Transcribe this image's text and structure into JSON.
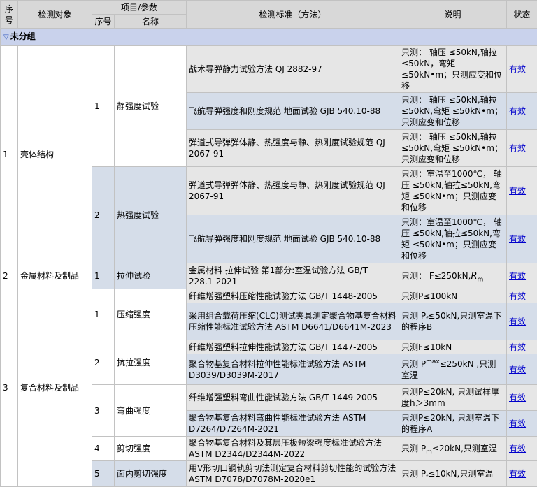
{
  "header": {
    "seq": "序号",
    "object": "检测对象",
    "param": "项目/参数",
    "sub_seq": "序号",
    "name": "名称",
    "standard": "检测标准（方法）",
    "note": "说明",
    "status": "状态"
  },
  "group": {
    "label": "未分组"
  },
  "status_label": "有效",
  "objects": [
    {
      "seq": "1",
      "name": "壳体结构",
      "params": [
        {
          "seq": "1",
          "name": "静强度试验",
          "standards": [
            {
              "text": "战术导弹静力试验方法 QJ 2882-97",
              "note": "只测： 轴压 ≤50kN,轴拉≤50kN，弯矩 ≤50kN•m；只测应变和位移"
            },
            {
              "text": "飞航导弹强度和刚度规范 地面试验 GJB 540.10-88",
              "note": "只测： 轴压 ≤50kN,轴拉≤50kN,弯矩 ≤50kN•m；只测应变和位移"
            },
            {
              "text": "弹道式导弹弹体静、热强度与静、热刚度试验规范 QJ 2067-91",
              "note": "只测： 轴压 ≤50kN,轴拉≤50kN,弯矩 ≤50kN•m；只测应变和位移"
            }
          ]
        },
        {
          "seq": "2",
          "name": "热强度试验",
          "standards": [
            {
              "text": "弹道式导弹弹体静、热强度与静、热刚度试验规范 QJ 2067-91",
              "note": "只测：室温至1000℃， 轴压 ≤50kN,轴拉≤50kN,弯矩 ≤50kN•m；只测应变和位移"
            },
            {
              "text": "飞航导弹强度和刚度规范 地面试验 GJB 540.10-88",
              "note": "只测：室温至1000℃， 轴压 ≤50kN,轴拉≤50kN,弯矩 ≤50kN•m；只测应变和位移"
            }
          ]
        }
      ]
    },
    {
      "seq": "2",
      "name": "金属材料及制品",
      "params": [
        {
          "seq": "1",
          "name": "拉伸试验",
          "standards": [
            {
              "text": "金属材料 拉伸试验 第1部分:室温试验方法 GB/T 228.1-2021",
              "note_pre": "只测： F≤250kN,",
              "note_rel": "R",
              "note_sub": "m"
            }
          ]
        }
      ]
    },
    {
      "seq": "3",
      "name": "复合材料及制品",
      "params": [
        {
          "seq": "1",
          "name": "压缩强度",
          "standards": [
            {
              "text": "纤维增强塑料压缩性能试验方法 GB/T 1448-2005",
              "note": "只测P≤100kN"
            },
            {
              "text": "采用组合载荷压缩(CLC)测试夹具测定聚合物基复合材料压缩性能标准试验方法 ASTM D6641/D6641M-2023",
              "note_pre": "只测 P",
              "note_sub": "f",
              "note_post": "≤50kN,只测室温下的程序B"
            }
          ]
        },
        {
          "seq": "2",
          "name": "抗拉强度",
          "standards": [
            {
              "text": "纤维增强塑料拉伸性能试验方法 GB/T 1447-2005",
              "note": "只测F≤10kN"
            },
            {
              "text": "聚合物基复合材料拉伸性能标准试验方法 ASTM D3039/D3039M-2017",
              "note_pre": "只测 P",
              "note_sup": "max",
              "note_post": "≤250kN ,只测室温"
            }
          ]
        },
        {
          "seq": "3",
          "name": "弯曲强度",
          "standards": [
            {
              "text": "纤维增强塑料弯曲性能试验方法 GB/T 1449-2005",
              "note": "只测P≤20kN, 只测试样厚度h＞3mm"
            },
            {
              "text": "聚合物基复合材料弯曲性能标准试验方法 ASTM D7264/D7264M-2021",
              "note": "只测P≤20kN, 只测室温下的程序A"
            }
          ]
        },
        {
          "seq": "4",
          "name": "剪切强度",
          "standards": [
            {
              "text": "聚合物基复合材料及其层压板短梁强度标准试验方法 ASTM D2344/D2344M-2022",
              "note_pre": "只测 P",
              "note_sub": "m",
              "note_post": "≤20kN,只测室温"
            }
          ]
        },
        {
          "seq": "5",
          "name": "面内剪切强度",
          "standards": [
            {
              "text": "用V形切口钢轨剪切法测定复合材料剪切性能的试验方法 ASTM D7078/D7078M-2020e1",
              "note_pre": "只测 P",
              "note_sub": "f",
              "note_post": "≤10kN,只测室温"
            }
          ]
        }
      ]
    }
  ]
}
